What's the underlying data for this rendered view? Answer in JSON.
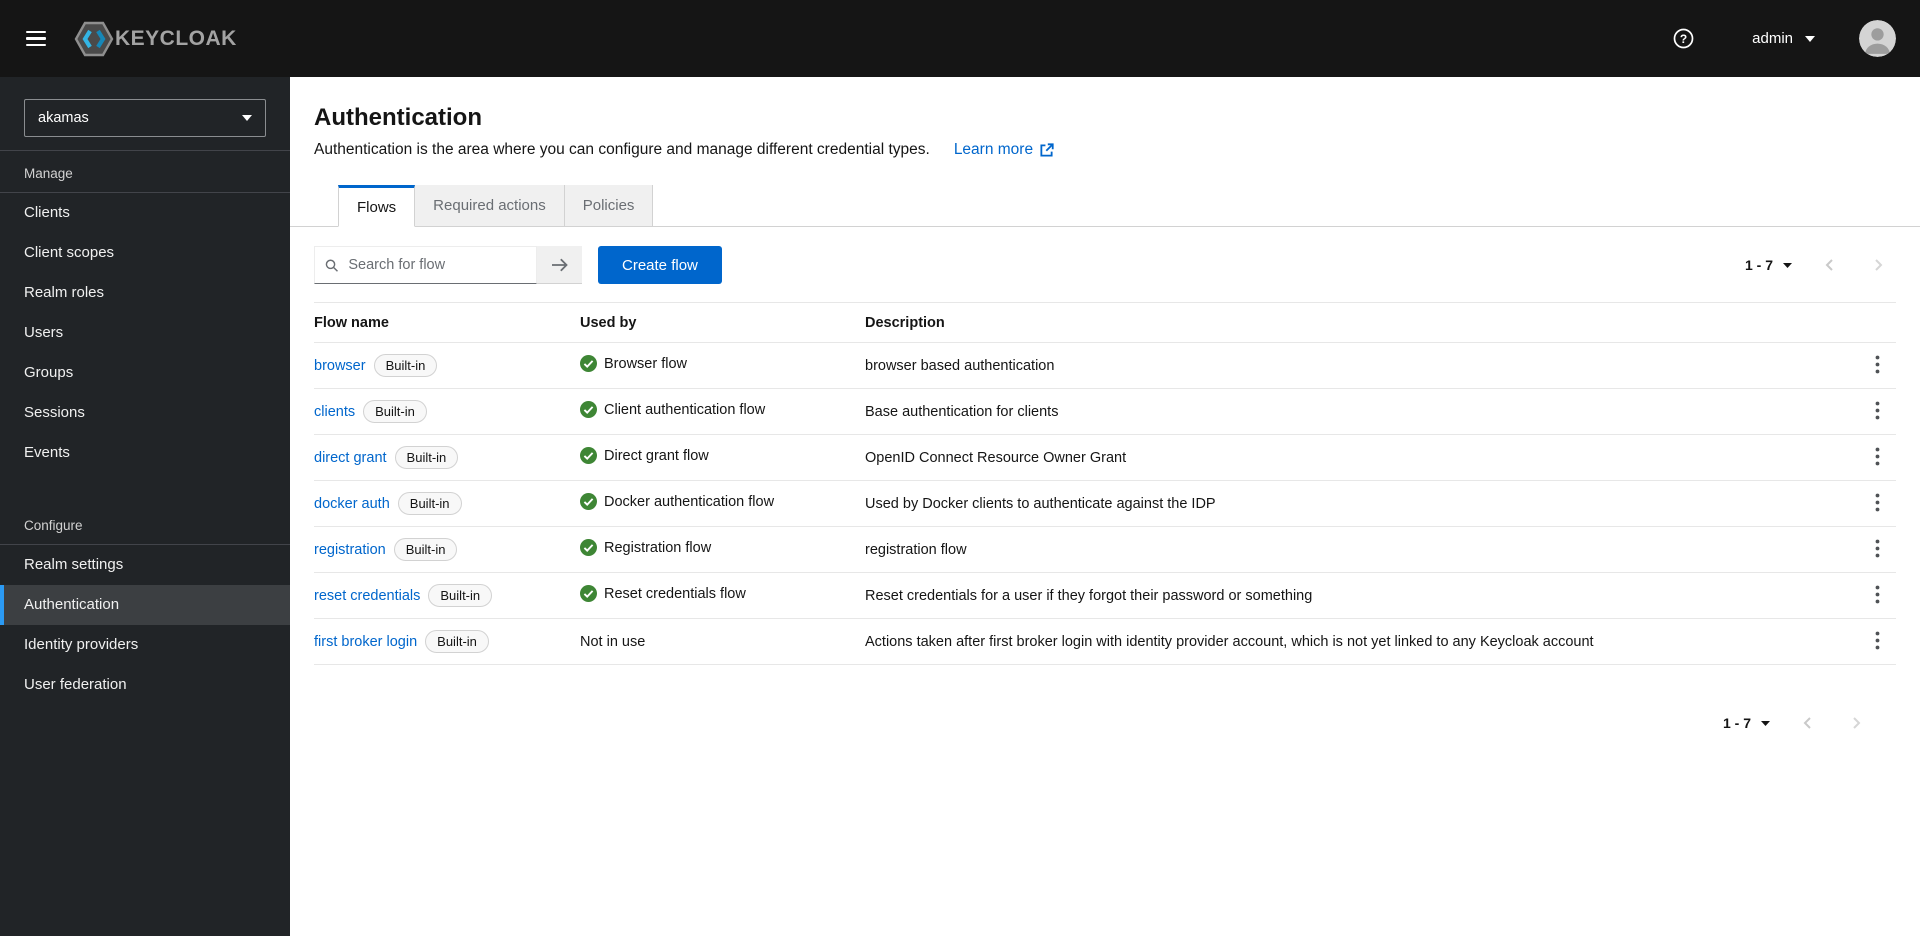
{
  "masthead": {
    "brand": "KEYCLOAK",
    "username": "admin"
  },
  "sidebar": {
    "realm": "akamas",
    "groups": [
      {
        "title": "Manage",
        "items": [
          "Clients",
          "Client scopes",
          "Realm roles",
          "Users",
          "Groups",
          "Sessions",
          "Events"
        ],
        "active": ""
      },
      {
        "title": "Configure",
        "items": [
          "Realm settings",
          "Authentication",
          "Identity providers",
          "User federation"
        ],
        "active": "Authentication"
      }
    ]
  },
  "page": {
    "title": "Authentication",
    "description": "Authentication is the area where you can configure and manage different credential types.",
    "learn_more": "Learn more",
    "tabs": [
      {
        "label": "Flows",
        "active": true
      },
      {
        "label": "Required actions",
        "active": false
      },
      {
        "label": "Policies",
        "active": false
      }
    ],
    "toolbar": {
      "search_placeholder": "Search for flow",
      "create_button": "Create flow",
      "pagination_range": "1 - 7"
    },
    "table": {
      "columns": [
        "Flow name",
        "Used by",
        "Description"
      ],
      "rows": [
        {
          "name": "browser",
          "badge": "Built-in",
          "used_by": "Browser flow",
          "used_by_status": "success",
          "description": "browser based authentication"
        },
        {
          "name": "clients",
          "badge": "Built-in",
          "used_by": "Client authentication flow",
          "used_by_status": "success",
          "description": "Base authentication for clients"
        },
        {
          "name": "direct grant",
          "badge": "Built-in",
          "used_by": "Direct grant flow",
          "used_by_status": "success",
          "description": "OpenID Connect Resource Owner Grant"
        },
        {
          "name": "docker auth",
          "badge": "Built-in",
          "used_by": "Docker authentication flow",
          "used_by_status": "success",
          "description": "Used by Docker clients to authenticate against the IDP"
        },
        {
          "name": "registration",
          "badge": "Built-in",
          "used_by": "Registration flow",
          "used_by_status": "success",
          "description": "registration flow"
        },
        {
          "name": "reset credentials",
          "badge": "Built-in",
          "used_by": "Reset credentials flow",
          "used_by_status": "success",
          "description": "Reset credentials for a user if they forgot their password or something"
        },
        {
          "name": "first broker login",
          "badge": "Built-in",
          "used_by": "Not in use",
          "used_by_status": "none",
          "description": "Actions taken after first broker login with identity provider account, which is not yet linked to any Keycloak account"
        }
      ]
    },
    "pagination_bottom_range": "1 - 7"
  },
  "colors": {
    "masthead_bg": "#151515",
    "sidebar_bg": "#212427",
    "sidebar_active_bg": "#3c3f42",
    "sidebar_active_border": "#2b9af3",
    "primary_button": "#0066cc",
    "link": "#0066cc",
    "success_green": "#3e8635",
    "tab_inactive_bg": "#f0f0f0",
    "border_gray": "#d2d2d2",
    "row_border": "#e7e7e7",
    "muted_text": "#6a6e73"
  }
}
